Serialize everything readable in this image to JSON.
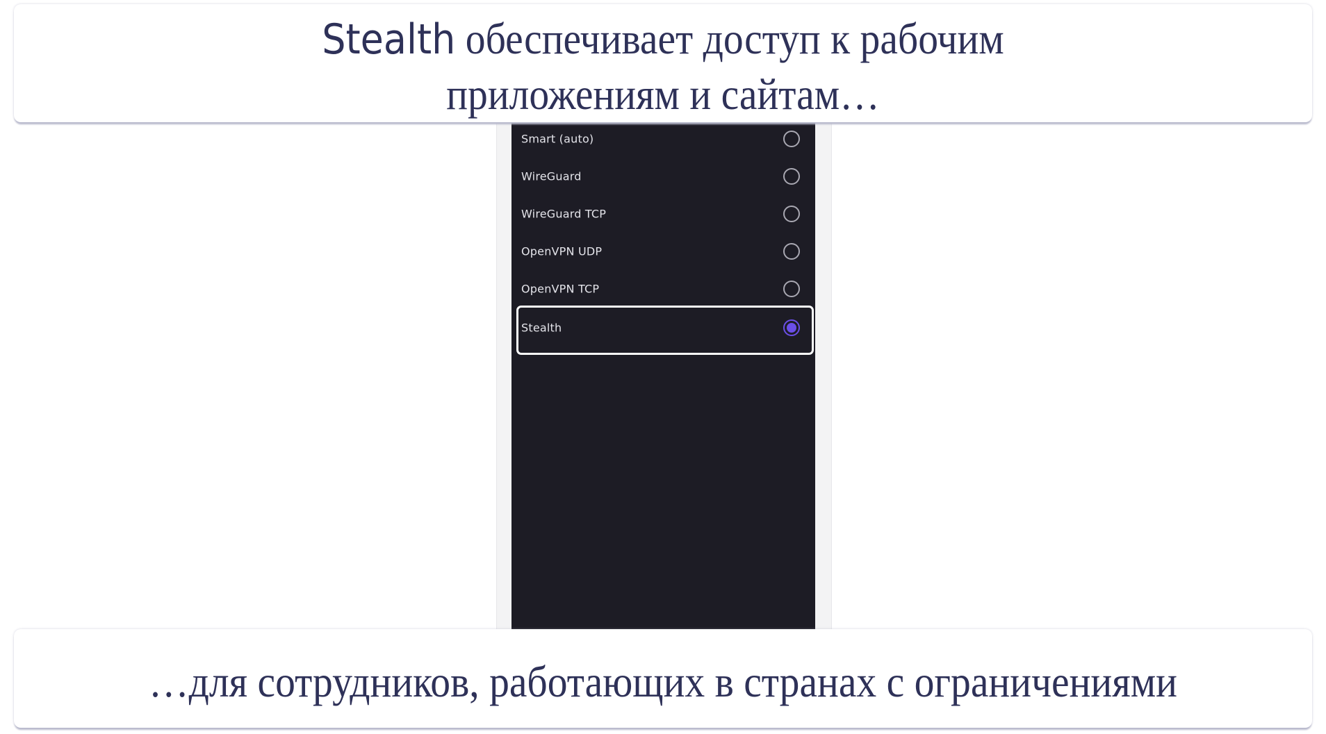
{
  "caption_top": {
    "highlight": "Stealth",
    "line1_rest": " обеспечивает доступ к рабочим",
    "line2": "приложениям и сайтам…"
  },
  "caption_bottom": {
    "text": "…для сотрудников, работающих в странах с ограничениями"
  },
  "protocol_list": {
    "options": [
      {
        "label": "Smart (auto)",
        "selected": false
      },
      {
        "label": "WireGuard",
        "selected": false
      },
      {
        "label": "WireGuard TCP",
        "selected": false
      },
      {
        "label": "OpenVPN UDP",
        "selected": false
      },
      {
        "label": "OpenVPN TCP",
        "selected": false
      },
      {
        "label": "Stealth",
        "selected": true
      }
    ],
    "selected_value": "Stealth"
  },
  "colors": {
    "accent": "#6b4fe8",
    "text_navy": "#2e3158",
    "screen_bg": "#1d1c25"
  }
}
